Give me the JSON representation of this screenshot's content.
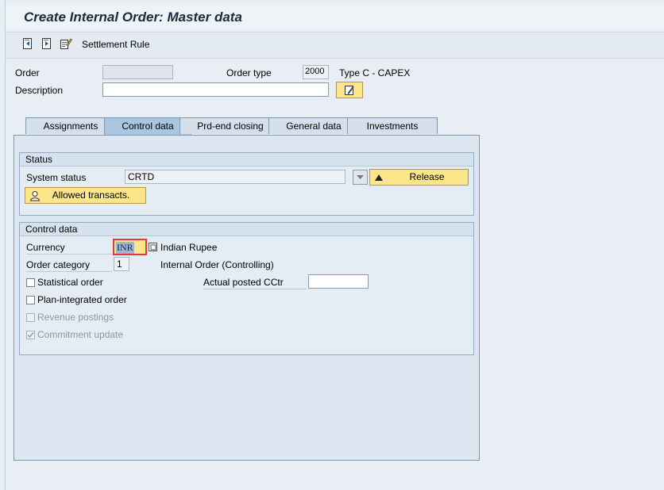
{
  "window": {
    "title": "Create Internal Order: Master data"
  },
  "toolbar": {
    "settlement_label": "Settlement Rule"
  },
  "header": {
    "order_label": "Order",
    "order_value": "",
    "order_type_label": "Order type",
    "order_type_value": "2000",
    "order_type_text": "Type C  - CAPEX",
    "description_label": "Description",
    "description_value": ""
  },
  "tabs": [
    {
      "label": "Assignments"
    },
    {
      "label": "Control data"
    },
    {
      "label": "Prd-end closing"
    },
    {
      "label": "General data"
    },
    {
      "label": "Investments"
    }
  ],
  "status": {
    "group_title": "Status",
    "system_status_label": "System status",
    "system_status_value": "CRTD",
    "release_label": "Release",
    "allowed_label": "Allowed transacts."
  },
  "control": {
    "group_title": "Control data",
    "currency_label": "Currency",
    "currency_value": "INR",
    "currency_text": "Indian Rupee",
    "order_category_label": "Order category",
    "order_category_value": "1",
    "order_category_text": "Internal Order (Controlling)",
    "statistical_label": "Statistical order",
    "actual_cctr_label": "Actual posted CCtr",
    "actual_cctr_value": "",
    "plan_integrated_label": "Plan-integrated order",
    "revenue_label": "Revenue postings",
    "commitment_label": "Commitment update"
  }
}
